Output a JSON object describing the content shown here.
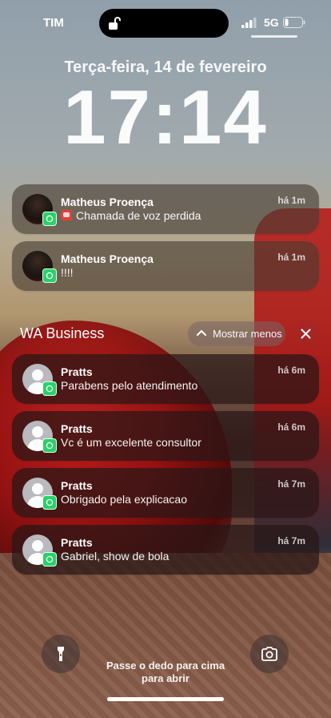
{
  "status_bar": {
    "carrier": "TIM",
    "network": "5G"
  },
  "lock_screen": {
    "date": "Terça-feira, 14 de fevereiro",
    "time": "17:14"
  },
  "notifications_top": [
    {
      "sender": "Matheus Proença",
      "message": "Chamada de voz perdida",
      "time": "há 1m",
      "icon": "missed-call-icon"
    },
    {
      "sender": "Matheus Proença",
      "message": "!!!!",
      "time": "há 1m"
    }
  ],
  "group": {
    "title": "WA Business",
    "show_less_label": "Mostrar menos",
    "items": [
      {
        "sender": "Pratts",
        "message": "Parabens pelo atendimento",
        "time": "há 6m"
      },
      {
        "sender": "Pratts",
        "message": "Vc é um excelente consultor",
        "time": "há 6m"
      },
      {
        "sender": "Pratts",
        "message": "Obrigado pela explicacao",
        "time": "há 7m"
      },
      {
        "sender": "Pratts",
        "message": "Gabriel, show de bola",
        "time": "há 7m"
      }
    ]
  },
  "bottom": {
    "hint_line1": "Passe o dedo para cima",
    "hint_line2": "para abrir"
  },
  "icons": [
    "lock-open-icon",
    "signal-icon",
    "battery-icon",
    "whatsapp-icon",
    "chevron-up-icon",
    "close-icon",
    "flashlight-icon",
    "camera-icon"
  ],
  "colors": {
    "whatsapp_green": "#25d366"
  }
}
